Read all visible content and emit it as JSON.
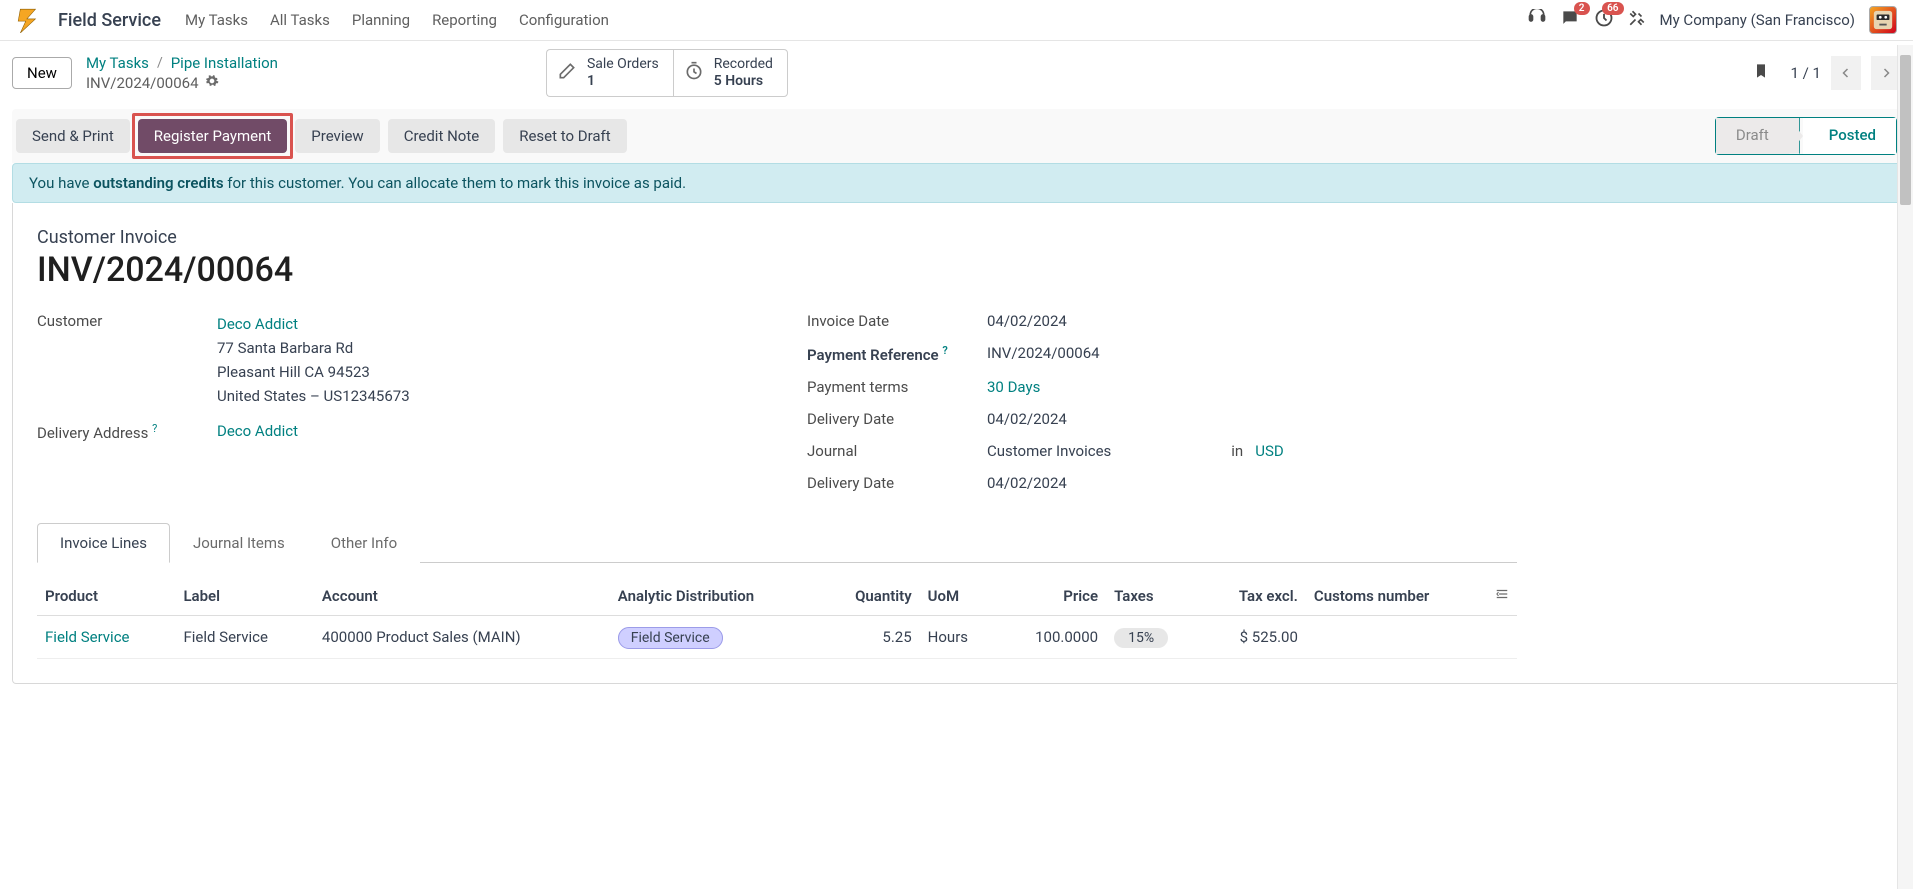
{
  "app": {
    "title": "Field Service",
    "nav": [
      "My Tasks",
      "All Tasks",
      "Planning",
      "Reporting",
      "Configuration"
    ],
    "company": "My Company (San Francisco)",
    "badges": {
      "messages": "2",
      "activities": "66"
    }
  },
  "control": {
    "new_label": "New",
    "breadcrumb1": "My Tasks",
    "breadcrumb2": "Pipe Installation",
    "subtitle": "INV/2024/00064",
    "stat1_label": "Sale Orders",
    "stat1_val": "1",
    "stat2_label": "Recorded",
    "stat2_val": "5 Hours",
    "pager": "1 / 1"
  },
  "actions": {
    "send_print": "Send & Print",
    "register_payment": "Register Payment",
    "preview": "Preview",
    "credit_note": "Credit Note",
    "reset_draft": "Reset to Draft",
    "status_draft": "Draft",
    "status_posted": "Posted"
  },
  "alert": {
    "pre": "You have ",
    "bold": "outstanding credits",
    "post": " for this customer. You can allocate them to mark this invoice as paid."
  },
  "sheet": {
    "doc_type": "Customer Invoice",
    "doc_number": "INV/2024/00064",
    "customer_label": "Customer",
    "customer_name": "Deco Addict",
    "addr_line1": "77 Santa Barbara Rd",
    "addr_line2": "Pleasant Hill CA 94523",
    "addr_line3": "United States – US12345673",
    "delivery_addr_label": "Delivery Address",
    "delivery_addr_val": "Deco Addict",
    "invoice_date_label": "Invoice Date",
    "invoice_date_val": "04/02/2024",
    "payment_ref_label": "Payment Reference",
    "payment_ref_val": "INV/2024/00064",
    "payment_terms_label": "Payment terms",
    "payment_terms_val": "30 Days",
    "delivery_date_label": "Delivery Date",
    "delivery_date_val": "04/02/2024",
    "journal_label": "Journal",
    "journal_val": "Customer Invoices",
    "journal_in": "in",
    "journal_currency": "USD",
    "delivery_date2_label": "Delivery Date",
    "delivery_date2_val": "04/02/2024"
  },
  "tabs": {
    "active": "Invoice Lines",
    "t2": "Journal Items",
    "t3": "Other Info"
  },
  "table": {
    "h_product": "Product",
    "h_label": "Label",
    "h_account": "Account",
    "h_analytic": "Analytic Distribution",
    "h_qty": "Quantity",
    "h_uom": "UoM",
    "h_price": "Price",
    "h_taxes": "Taxes",
    "h_taxexcl": "Tax excl.",
    "h_customs": "Customs number",
    "row1": {
      "product": "Field Service",
      "label": "Field Service",
      "account": "400000 Product Sales (MAIN)",
      "analytic": "Field Service",
      "qty": "5.25",
      "uom": "Hours",
      "price": "100.0000",
      "taxes": "15%",
      "taxexcl": "$ 525.00",
      "customs": ""
    }
  }
}
